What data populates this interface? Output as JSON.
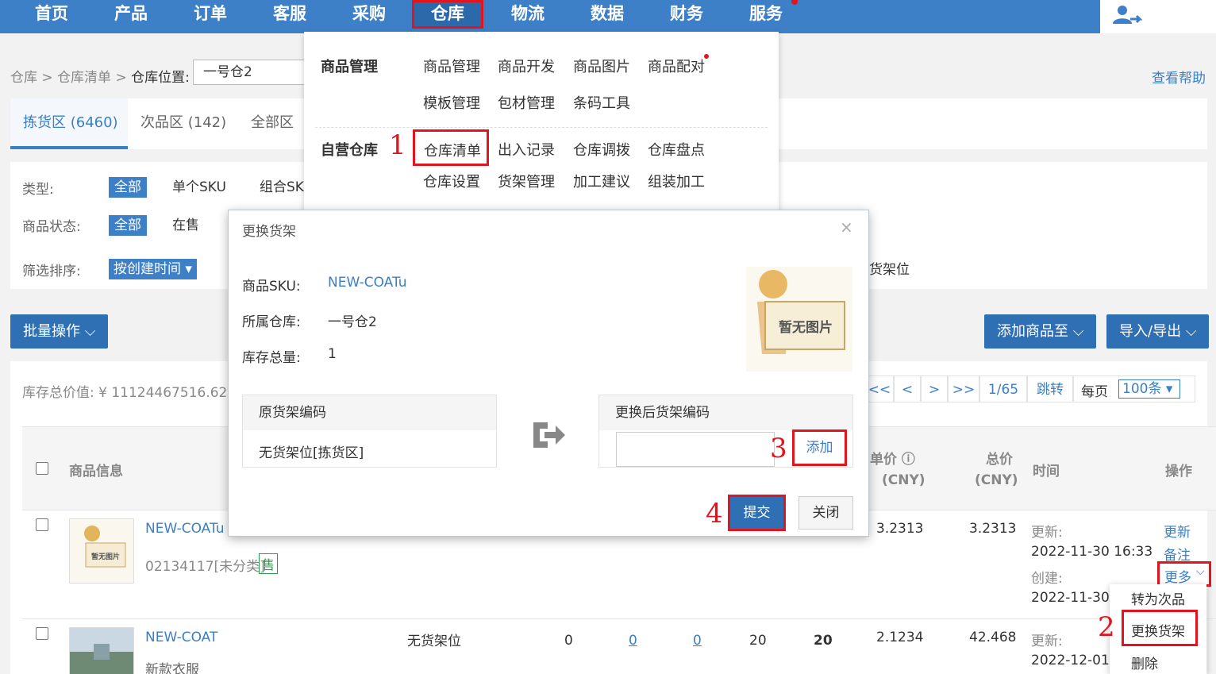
{
  "nav": {
    "items": [
      "首页",
      "产品",
      "订单",
      "客服",
      "采购",
      "仓库",
      "物流",
      "数据",
      "财务",
      "服务"
    ],
    "active": "仓库"
  },
  "breadcrumb": {
    "root": "仓库",
    "list": "仓库清单",
    "location_label": "仓库位置:",
    "warehouse": "一号仓2"
  },
  "help_link": "查看帮助",
  "tabs": [
    "拣货区 (6460)",
    "次品区 (142)",
    "全部区"
  ],
  "filter": {
    "type_label": "类型:",
    "type_all": "全部",
    "type_single": "单个SKU",
    "type_combo": "组合SK",
    "status_label": "商品状态:",
    "status_all": "全部",
    "status_onsale": "在售",
    "sort_label": "筛选排序:",
    "sort_value": "按创建时间 ▾",
    "shelf_fragment": "货架位"
  },
  "actions": {
    "batch": "批量操作",
    "add_to": "添加商品至",
    "import_export": "导入/导出"
  },
  "panel": {
    "stock_total": "库存总价值: ¥ 11124467516.624",
    "pager": [
      "<<",
      "<",
      ">",
      ">>",
      "1/65",
      "跳转"
    ],
    "per_page_label": "每页",
    "per_page_value": "100条 ▾"
  },
  "table": {
    "headers": {
      "product": "商品信息",
      "unit_price": "单价 ⓘ",
      "unit_price_cur": "(CNY)",
      "total_price": "总价",
      "total_price_cur": "(CNY)",
      "time": "时间",
      "ops": "操作"
    },
    "rows": [
      {
        "sku": "NEW-COATu",
        "sub": "02134117[未分类]",
        "badge": "售",
        "unit": "3.2313",
        "total": "3.2313",
        "updated_label": "更新:",
        "updated": "2022-11-30 16:33",
        "created_label": "创建:",
        "created": "2022-11-30",
        "ops": [
          "更新",
          "备注",
          "更多"
        ]
      },
      {
        "sku": "NEW-COAT",
        "sub": "新款衣服",
        "shelf": "无货架位",
        "q1": "0",
        "q2": "0",
        "q3": "0",
        "q4": "20",
        "q5": "20",
        "unit": "2.1234",
        "total": "42.468",
        "updated_label": "更新:",
        "updated": "2022-12-01"
      }
    ]
  },
  "menu": {
    "section1": "商品管理",
    "section1_items": [
      "商品管理",
      "商品开发",
      "商品图片",
      "商品配对",
      "模板管理",
      "包材管理",
      "条码工具"
    ],
    "section2": "自营仓库",
    "section2_items": [
      "仓库清单",
      "出入记录",
      "仓库调拨",
      "仓库盘点",
      "仓库设置",
      "货架管理",
      "加工建议",
      "组装加工"
    ]
  },
  "dialog": {
    "title": "更换货架",
    "close": "×",
    "sku_label": "商品SKU:",
    "sku_value": "NEW-COATu",
    "wh_label": "所属仓库:",
    "wh_value": "一号仓2",
    "qty_label": "库存总量:",
    "qty_value": "1",
    "no_image": "暂无图片",
    "old_head": "原货架编码",
    "old_value": "无货架位[拣货区]",
    "new_head": "更换后货架编码",
    "add": "添加",
    "submit": "提交",
    "close_btn": "关闭"
  },
  "more_menu": [
    "转为次品",
    "更换货架",
    "删除"
  ],
  "steps": [
    "1",
    "2",
    "3",
    "4"
  ],
  "colors": {
    "accent": "#3d80c8",
    "highlight": "#e3141e"
  }
}
